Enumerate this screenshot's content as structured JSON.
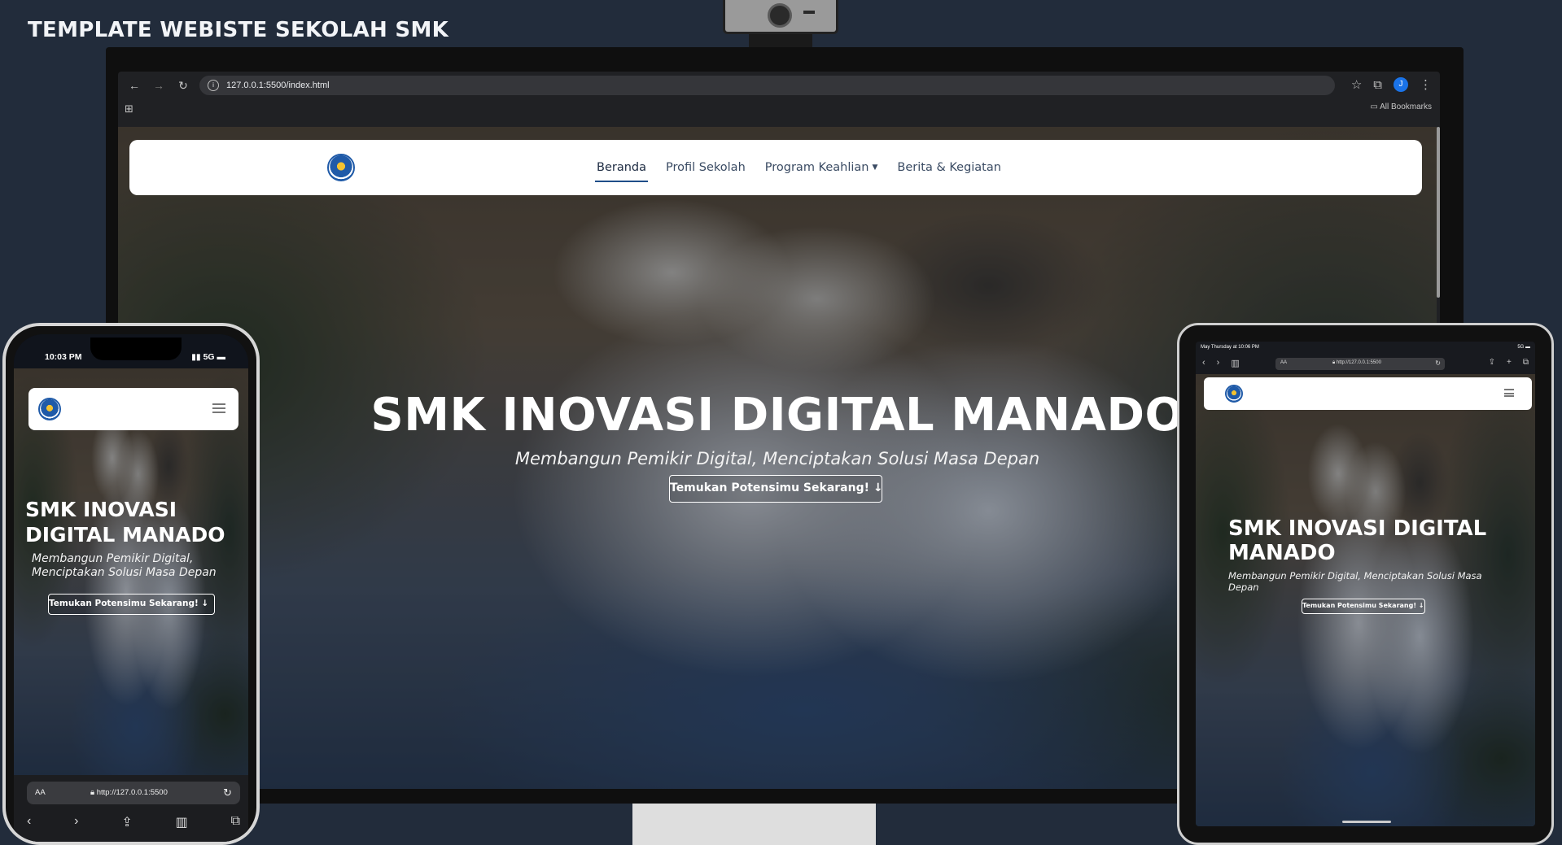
{
  "heading": "TEMPLATE WEBISTE SEKOLAH SMK",
  "browser": {
    "url": "127.0.0.1:5500/index.html",
    "bookmarks_label": "All Bookmarks",
    "profile_initial": "J"
  },
  "site": {
    "nav": [
      "Beranda",
      "Profil Sekolah",
      "Program Keahlian",
      "Berita & Kegiatan"
    ],
    "active_nav": "Beranda",
    "hero_title": "SMK INOVASI DIGITAL MANADO",
    "hero_subtitle": "Membangun Pemikir Digital, Menciptakan Solusi Masa Depan",
    "cta": "Temukan Potensimu Sekarang! ↓"
  },
  "phone": {
    "time": "10:03 PM",
    "signal": "5G",
    "url": "http://127.0.0.1:5500",
    "text_size": "AA"
  },
  "tablet": {
    "status_left": "May Thursday at 10:06 PM",
    "status_right": "5G",
    "url": "http://127.0.0.1:5500",
    "text_size": "AA"
  }
}
